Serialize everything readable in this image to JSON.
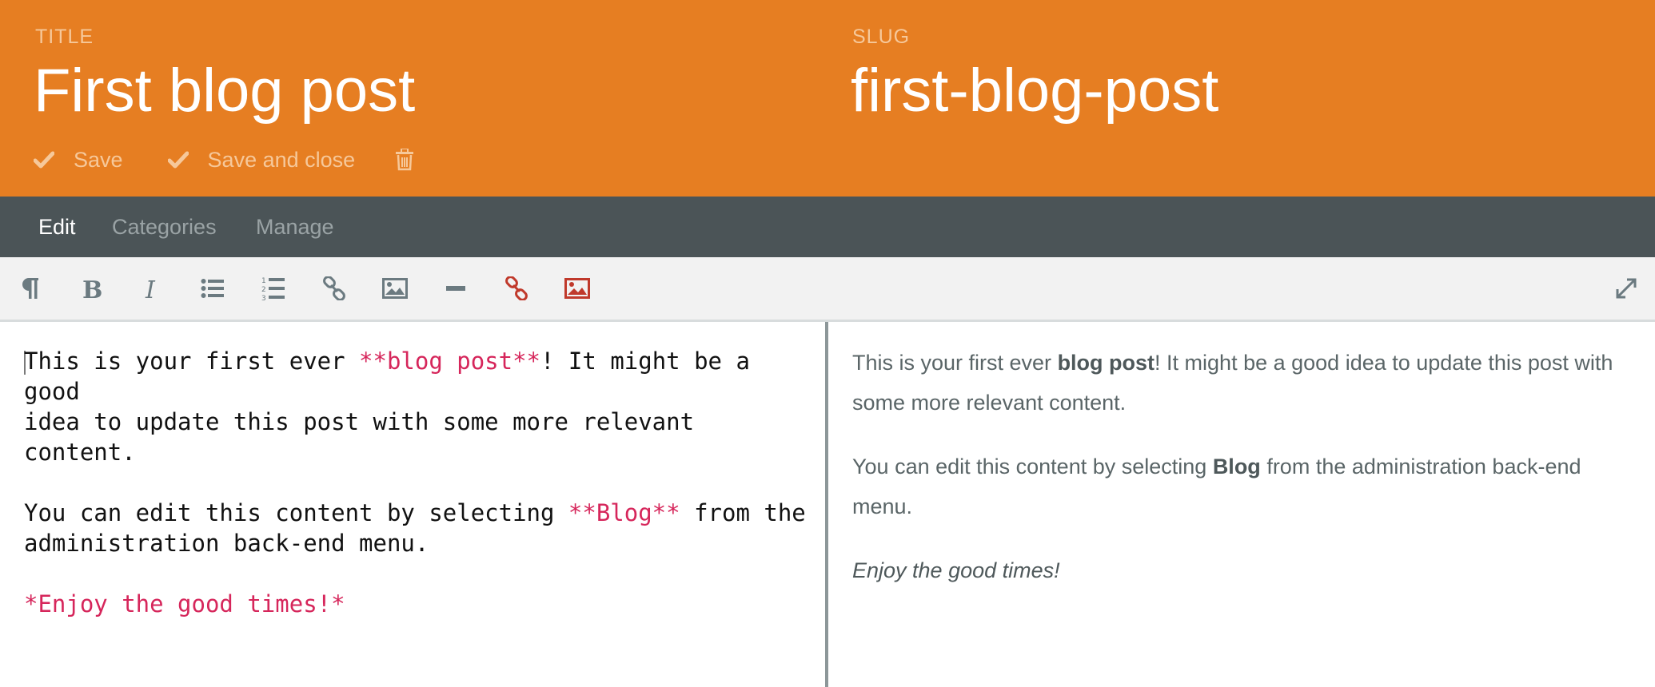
{
  "header": {
    "title_label": "TITLE",
    "title_value": "First blog post",
    "slug_label": "SLUG",
    "slug_value": "first-blog-post",
    "save_label": "Save",
    "save_close_label": "Save and close"
  },
  "tabs": [
    {
      "label": "Edit",
      "active": true
    },
    {
      "label": "Categories",
      "active": false
    },
    {
      "label": "Manage",
      "active": false
    }
  ],
  "toolbar": {
    "buttons": [
      "paragraph-icon",
      "bold-icon",
      "italic-icon",
      "bullet-list-icon",
      "numbered-list-icon",
      "link-icon",
      "image-icon",
      "horizontal-rule-icon",
      "media-link-icon",
      "media-image-icon",
      "fullscreen-icon"
    ]
  },
  "editor": {
    "p1_a": "This is your first ever ",
    "p1_md": "**blog post**",
    "p1_b": "! It might be a good\nidea to update this post with some more relevant content.",
    "p2_a": "You can edit this content by selecting ",
    "p2_md": "**Blog**",
    "p2_b": " from the\nadministration back-end menu.",
    "p3_md": "*Enjoy the good times!*"
  },
  "preview": {
    "p1_a": "This is your first ever ",
    "p1_bold": "blog post",
    "p1_b": "! It might be a good idea to update this post with some more relevant content.",
    "p2_a": "You can edit this content by selecting ",
    "p2_bold": "Blog",
    "p2_b": " from the administration back-end menu.",
    "p3_italic": "Enjoy the good times!"
  },
  "colors": {
    "header_bg": "#e67e22",
    "tabbar_bg": "#4b5457",
    "toolbar_bg": "#f2f2f2",
    "toolbar_icon": "#6b7a80",
    "media_icon": "#c0392b",
    "markdown_accent": "#d6265b"
  }
}
